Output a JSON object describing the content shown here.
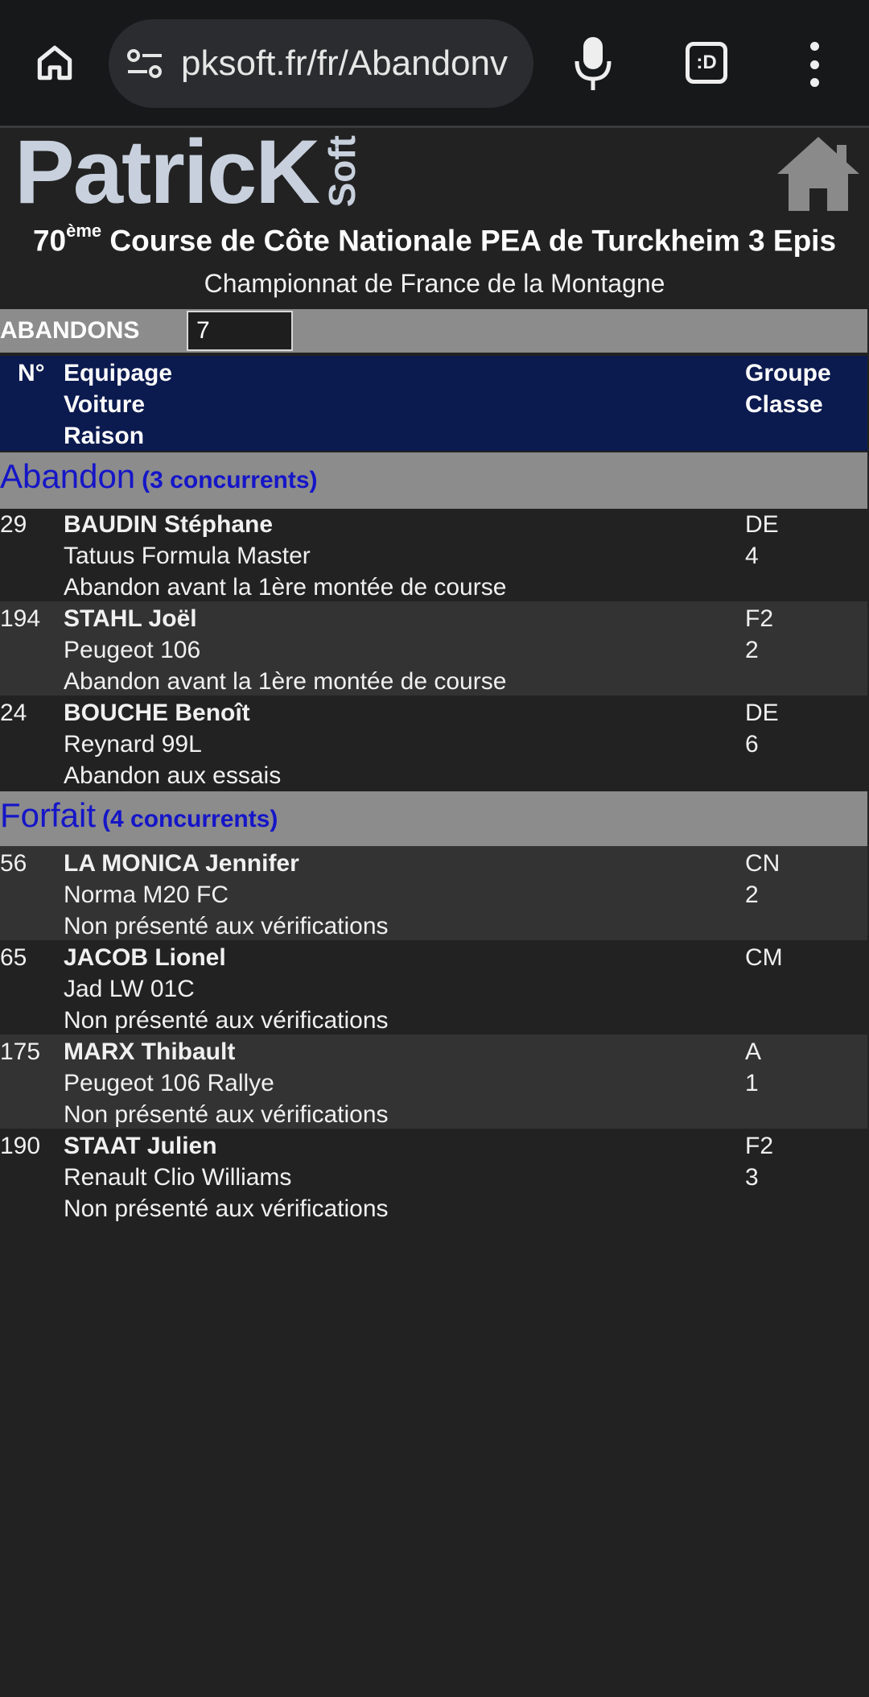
{
  "browser": {
    "url": "pksoft.fr/fr/Abandonv",
    "tabs_label": ":D"
  },
  "header": {
    "logo_main": "PatricK",
    "logo_side": "Soft",
    "title_number": "70",
    "title_sup": "ème",
    "title_rest": " Course de Côte Nationale PEA de Turckheim 3 Epis",
    "subtitle": "Championnat de France de la Montagne"
  },
  "countbar": {
    "label": "ABANDONS",
    "value": "7"
  },
  "table_header": {
    "num": "N°",
    "col_main": [
      "Equipage",
      "Voiture",
      "Raison"
    ],
    "col_group": [
      "Groupe",
      "Classe"
    ]
  },
  "sections": [
    {
      "title": "Abandon",
      "count": "(3 concurrents)",
      "rows": [
        {
          "num": "29",
          "driver": "BAUDIN Stéphane",
          "car": "Tatuus Formula Master",
          "reason": "Abandon avant la 1ère montée de course",
          "group": "DE",
          "class": "4"
        },
        {
          "num": "194",
          "driver": "STAHL Joël",
          "car": "Peugeot 106",
          "reason": "Abandon avant la 1ère montée de course",
          "group": "F2",
          "class": "2"
        },
        {
          "num": "24",
          "driver": "BOUCHE Benoît",
          "car": "Reynard 99L",
          "reason": "Abandon aux essais",
          "group": "DE",
          "class": "6"
        }
      ]
    },
    {
      "title": "Forfait",
      "count": "(4 concurrents)",
      "rows": [
        {
          "num": "56",
          "driver": "LA MONICA Jennifer",
          "car": "Norma M20 FC",
          "reason": "Non présenté aux vérifications",
          "group": "CN",
          "class": "2"
        },
        {
          "num": "65",
          "driver": "JACOB Lionel",
          "car": "Jad LW 01C",
          "reason": "Non présenté aux vérifications",
          "group": "CM",
          "class": ""
        },
        {
          "num": "175",
          "driver": "MARX Thibault",
          "car": "Peugeot 106 Rallye",
          "reason": "Non présenté aux vérifications",
          "group": "A",
          "class": "1"
        },
        {
          "num": "190",
          "driver": "STAAT Julien",
          "car": "Renault Clio Williams",
          "reason": "Non présenté aux vérifications",
          "group": "F2",
          "class": "3"
        }
      ]
    }
  ]
}
